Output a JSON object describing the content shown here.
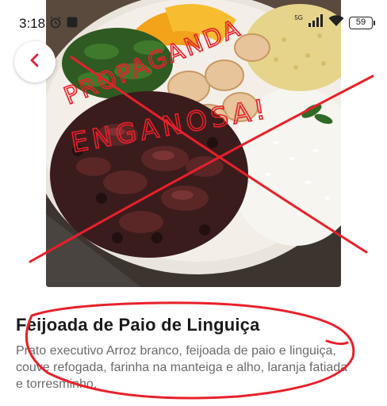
{
  "status_bar": {
    "time": "3:18",
    "network": "5G",
    "battery": "59",
    "icons": [
      "alarm-icon",
      "app-notification-icon",
      "signal-icon",
      "wifi-icon",
      "battery-icon"
    ]
  },
  "navigation": {
    "back_icon": "chevron-left-icon"
  },
  "dish": {
    "title": "Feijoada de Paio de Linguiça",
    "description": "Prato executivo Arroz branco, feijoada de paio e linguiça, couve refogada, farinha na manteiga e alho, laranja fatiada e torresminho."
  },
  "annotation": {
    "handwritten_text_line1": "PROPAGANDA",
    "handwritten_text_line2": "ENGANOSA!",
    "color": "#e8202a"
  },
  "colors": {
    "accent": "#d9223a",
    "title": "#1a1a1a",
    "description": "#6a6a6a"
  }
}
